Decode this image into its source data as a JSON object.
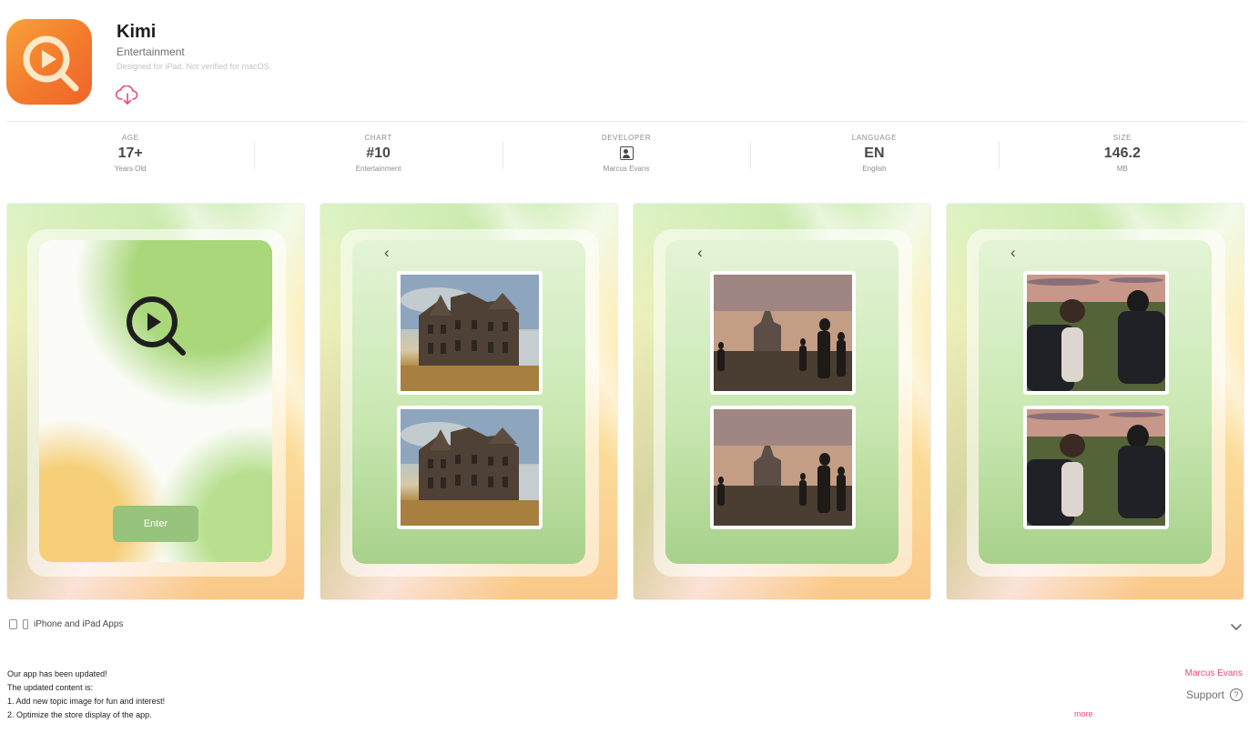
{
  "app": {
    "name": "Kimi",
    "category": "Entertainment",
    "note": "Designed for iPad. Not verified for macOS.",
    "icon": "kimi-play-search-icon",
    "accent": "#e84b7a"
  },
  "info": [
    {
      "label": "AGE",
      "value": "17+",
      "sub": "Years Old"
    },
    {
      "label": "CHART",
      "value": "#10",
      "sub": "Entertainment"
    },
    {
      "label": "DEVELOPER",
      "value": "",
      "sub": "Marcus Evans",
      "icon": "person-icon"
    },
    {
      "label": "LANGUAGE",
      "value": "EN",
      "sub": "English"
    },
    {
      "label": "SIZE",
      "value": "146.2",
      "sub": "MB"
    }
  ],
  "screenshots": {
    "enter_label": "Enter"
  },
  "compat": {
    "label": "iPhone and iPad Apps"
  },
  "notes": [
    "Our app has been updated!",
    "The updated content is:",
    "1. Add new topic image for fun and interest!",
    "2. Optimize the store display of the app."
  ],
  "sidebar": {
    "developer": "Marcus Evans",
    "support": "Support",
    "more": "more"
  }
}
